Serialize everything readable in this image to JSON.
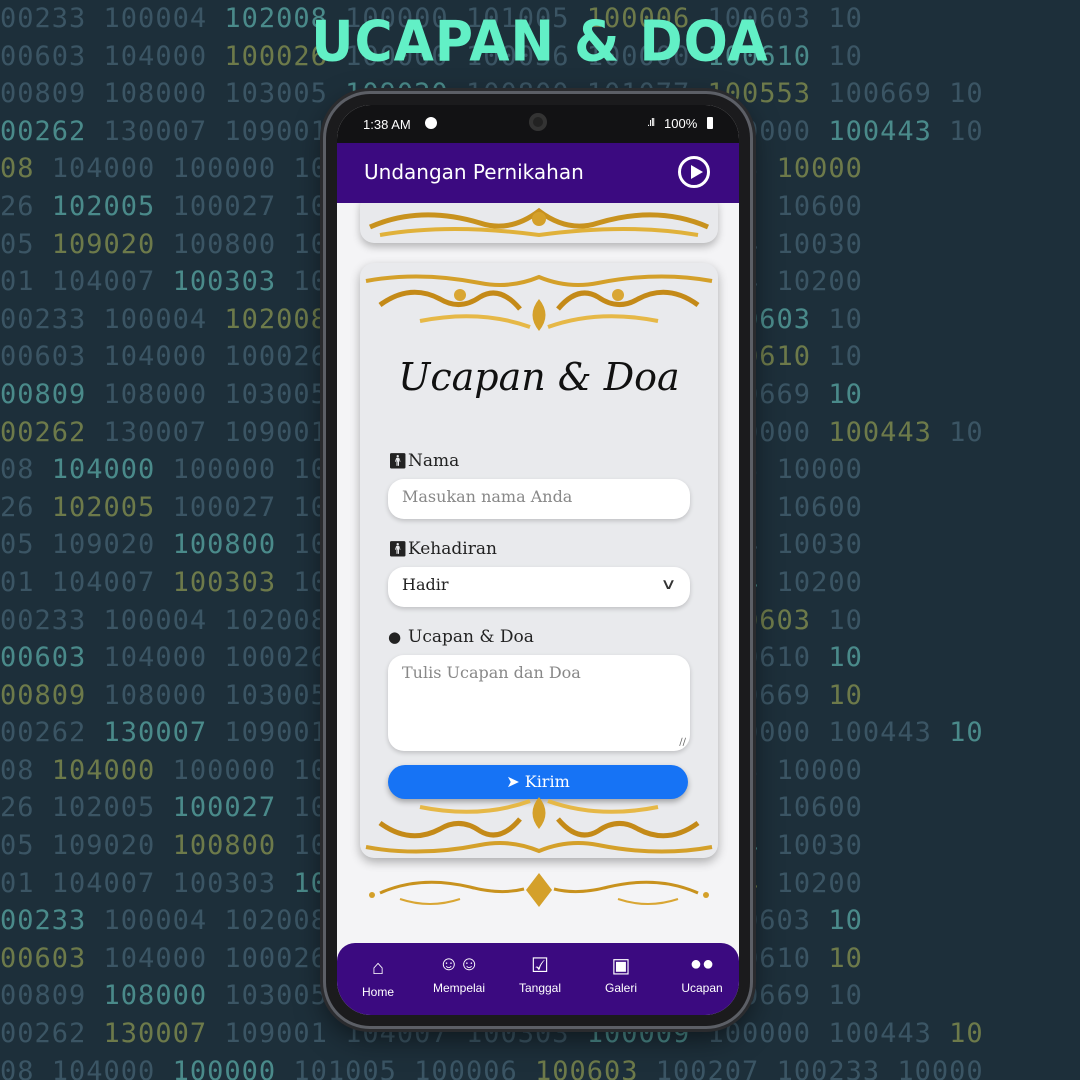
{
  "headline": "UCAPAN & DOA",
  "code_lines": [
    "00233 100004 102008 100000 101005 100006 100603 10",
    "00603 104000 100026 100000 100056 100000 100610 10",
    "00809 108000 103005 109020 100800 101077 100553 100669 10",
    "00262 130007 109001 104007 100303 100009 100000 100443 10",
    "08 104000 100000 101005 100006 100207 100233 10000",
    "26 102005 100027 100207 100233 103029 100902 10600",
    "05 109020 100800 101077 100553 100012 100834 10030",
    "01 104007 100303 100009 100000 100202 100914 10200",
    "00233 100004 102008 100000 101005 100006 100603 10",
    "00603 104000 100026 100000 100056 100000 100610 10",
    "00809 108000 103005 109020 100800 100553 100669 10",
    "00262 130007 109001 104007 100303 100009 100000 100443 10",
    "08 104000 100000 101005 100006 100207 100233 10000",
    "26 102005 100027 100207 100233 103029 100902 10600",
    "05 109020 100800 101077 100553 100012 100834 10030",
    "01 104007 100303 100009 100000 100202 100914 10200",
    "00233 100004 102008 100000 101005 100006 100603 10",
    "00603 104000 100026 100000 100056 100000 100610 10",
    "00809 108000 103005 109020 100800 100553 100669 10",
    "00262 130007 109001 104007 100303 100009 100000 100443 10",
    "08 104000 100000 101005 100006 100207 100233 10000",
    "26 102005 100027 100207 100233 103029 100902 10600",
    "05 109020 100800 101077 100553 100012 100834 10030",
    "01 104007 100303 100009 100000 100202 100914 10200",
    "00233 100004 102008 100000 101005 100006 100603 10",
    "00603 104000 100026 100000 100056 100000 100610 10",
    "00809 108000 103005 109020 100800 100553 100669 10",
    "00262 130007 109001 104007 100303 100009 100000 100443 10",
    "08 104000 100000 101005 100006 100603 100207 100233 10000"
  ],
  "status_bar": {
    "time": "1:38 AM",
    "battery": "100%"
  },
  "app_bar": {
    "title": "Undangan Pernikahan",
    "play_icon": "play-circle-icon"
  },
  "form": {
    "title": "Ucapan & Doa",
    "name_label": "Nama",
    "name_placeholder": "Masukan nama Anda",
    "attendance_label": "Kehadiran",
    "attendance_value": "Hadir",
    "message_label": "Ucapan & Doa",
    "message_placeholder": "Tulis Ucapan dan Doa",
    "submit_label": "Kirim"
  },
  "nav": [
    {
      "label": "Home",
      "icon": "home-icon"
    },
    {
      "label": "Mempelai",
      "icon": "people-icon"
    },
    {
      "label": "Tanggal",
      "icon": "calendar-check-icon"
    },
    {
      "label": "Galeri",
      "icon": "images-icon"
    },
    {
      "label": "Ucapan",
      "icon": "chat-bubbles-icon"
    }
  ],
  "colors": {
    "background": "#1d2f3a",
    "headline": "#62f0c6",
    "app_bar": "#3b0a80",
    "submit_button": "#1673f5",
    "ornament_gold": "#d4a02a"
  }
}
